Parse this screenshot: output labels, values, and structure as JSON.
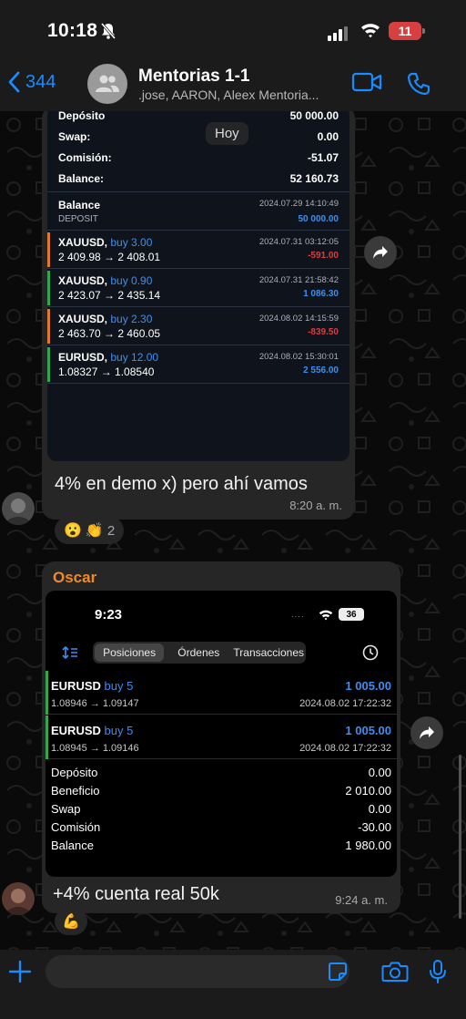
{
  "status": {
    "time": "10:18",
    "battery": "11"
  },
  "header": {
    "back_count": "344",
    "title": "Mentorias 1-1",
    "subtitle": ".jose, AARON, Aleex Mentoria..."
  },
  "date_chip": "Hoy",
  "msg1": {
    "summary": [
      {
        "label": "Depósito",
        "value": "50 000.00"
      },
      {
        "label": "Swap:",
        "value": "0.00"
      },
      {
        "label": "Comisión:",
        "value": "-51.07"
      },
      {
        "label": "Balance:",
        "value": "52 160.73"
      }
    ],
    "balance_entry": {
      "title": "Balance",
      "type": "DEPOSIT",
      "date": "2024.07.29 14:10:49",
      "amount": "50 000.00"
    },
    "deals": [
      {
        "symbol": "XAUUSD,",
        "side": "buy 3.00",
        "prices": "2 409.98 → 2 408.01",
        "date": "2024.07.31 03:12:05",
        "profit": "-591.00",
        "bar": "#e07a2a",
        "profit_color": "#e0393e"
      },
      {
        "symbol": "XAUUSD,",
        "side": "buy 0.90",
        "prices": "2 423.07 → 2 435.14",
        "date": "2024.07.31 21:58:42",
        "profit": "1 086.30",
        "bar": "#2fa84f",
        "profit_color": "#3d8ef0"
      },
      {
        "symbol": "XAUUSD,",
        "side": "buy 2.30",
        "prices": "2 463.70 → 2 460.05",
        "date": "2024.08.02 14:15:59",
        "profit": "-839.50",
        "bar": "#e07a2a",
        "profit_color": "#e0393e"
      },
      {
        "symbol": "EURUSD,",
        "side": "buy 12.00",
        "prices": "1.08327 → 1.08540",
        "date": "2024.08.02 15:30:01",
        "profit": "2 556.00",
        "bar": "#2fa84f",
        "profit_color": "#3d8ef0"
      }
    ],
    "text": "4% en demo x) pero ahí vamos",
    "time": "8:20 a. m.",
    "reactions": {
      "emojis": [
        "😮",
        "👏"
      ],
      "count": "2"
    }
  },
  "msg2": {
    "sender": "Oscar",
    "inner_time": "9:23",
    "inner_battery": "36",
    "tabs": [
      "Posiciones",
      "Órdenes",
      "Transacciones"
    ],
    "positions": [
      {
        "symbol": "EURUSD",
        "side": "buy 5",
        "prices": "1.08946 → 1.09147",
        "profit": "1 005.00",
        "date": "2024.08.02 17:22:32"
      },
      {
        "symbol": "EURUSD",
        "side": "buy 5",
        "prices": "1.08945 → 1.09146",
        "profit": "1 005.00",
        "date": "2024.08.02 17:22:32"
      }
    ],
    "summary": [
      {
        "label": "Depósito",
        "value": "0.00"
      },
      {
        "label": "Beneficio",
        "value": "2 010.00"
      },
      {
        "label": "Swap",
        "value": "0.00"
      },
      {
        "label": "Comisión",
        "value": "-30.00"
      },
      {
        "label": "Balance",
        "value": "1 980.00"
      }
    ],
    "text": "+4% cuenta real 50k",
    "time": "9:24 a. m.",
    "reaction": "💪"
  }
}
